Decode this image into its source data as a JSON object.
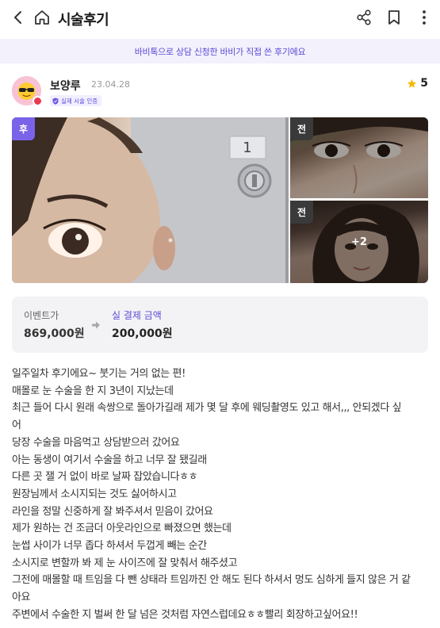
{
  "header": {
    "title": "시술후기",
    "back_icon": "chevron-left-icon",
    "home_icon": "home-icon",
    "share_icon": "share-icon",
    "bookmark_icon": "bookmark-icon",
    "more_icon": "more-vertical-icon"
  },
  "banner": {
    "text": "바비톡으로 상담 신청한 바비가 직접 쓴 후기에요"
  },
  "author": {
    "name": "보양루",
    "date": "23.04.28",
    "badge": "실제 시술 인증",
    "rating": "5"
  },
  "photos": {
    "main_tag": "후",
    "before_tag_1": "전",
    "before_tag_2": "전",
    "more_count": "+2"
  },
  "price": {
    "event_label": "이벤트가",
    "event_value": "869,000원",
    "paid_label": "실 결제 금액",
    "paid_value": "200,000원"
  },
  "review": {
    "lines": [
      "일주일차 후기에요~ 붓기는 거의 없는 편!",
      "매몰로 눈 수술을 한 지 3년이 지났는데",
      "최근 들어 다시 원래 속쌍으로 돌아가길래 제가 몇 달 후에 웨딩촬영도 있고 해서,,, 안되겠다 싶",
      "어",
      "당장 수술을 마음먹고 상담받으러 갔어요",
      "아는 동생이 여기서 수술을 하고 너무 잘 됐길래",
      "다른 곳 잴 거 없이 바로 날짜 잡았습니다ㅎㅎ",
      "원장님께서 소시지되는 것도 싫어하시고",
      "라인을 정말 신중하게 잘 봐주셔서 믿음이 갔어요",
      "제가 원하는 건 조금더 아웃라인으로 빠졌으면 했는데",
      "눈썹 사이가 너무 좁다 하셔서 두껍게 빼는 순간",
      "소시지로 변할까 봐 제 눈 사이즈에 잘 맞춰서 해주셨고",
      "그전에 매몰할 때 트임을 다 뺀 상태라 트임까진 안 해도 된다 하셔서 멍도 심하게 들지 않은 거 같",
      "아요",
      "주변에서 수술한 지 벌써 한 달 넘은 것처럼 자연스럽데요ㅎㅎ빨리 회장하고싶어요!!"
    ]
  },
  "colors": {
    "accent": "#5b4bd6",
    "after_tag": "#7a63e8",
    "star": "#f5b700",
    "banner_bg": "#f3f1fc"
  }
}
